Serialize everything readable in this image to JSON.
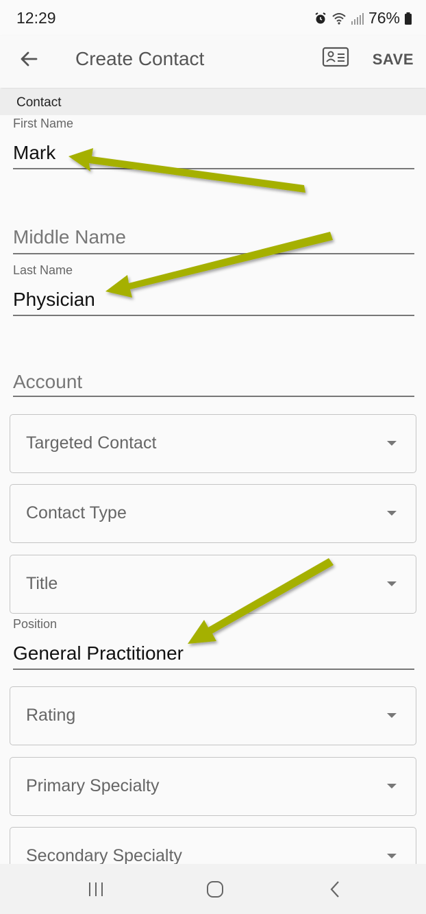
{
  "status": {
    "time": "12:29",
    "battery": "76%"
  },
  "app_bar": {
    "title": "Create Contact",
    "save_label": "SAVE"
  },
  "section": {
    "title": "Contact"
  },
  "fields": {
    "first_name": {
      "label": "First Name",
      "value": "Mark"
    },
    "middle_name": {
      "placeholder": "Middle Name"
    },
    "last_name": {
      "label": "Last Name",
      "value": "Physician"
    },
    "account": {
      "placeholder": "Account"
    },
    "position": {
      "label": "Position",
      "value": "General Practitioner"
    }
  },
  "dropdowns": {
    "targeted_contact": "Targeted Contact",
    "contact_type": "Contact Type",
    "title": "Title",
    "rating": "Rating",
    "primary_specialty": "Primary Specialty",
    "secondary_specialty": "Secondary Specialty"
  },
  "colors": {
    "annotation_arrow": "#a5b000",
    "background": "#fafafa",
    "section_header": "#ededed"
  }
}
